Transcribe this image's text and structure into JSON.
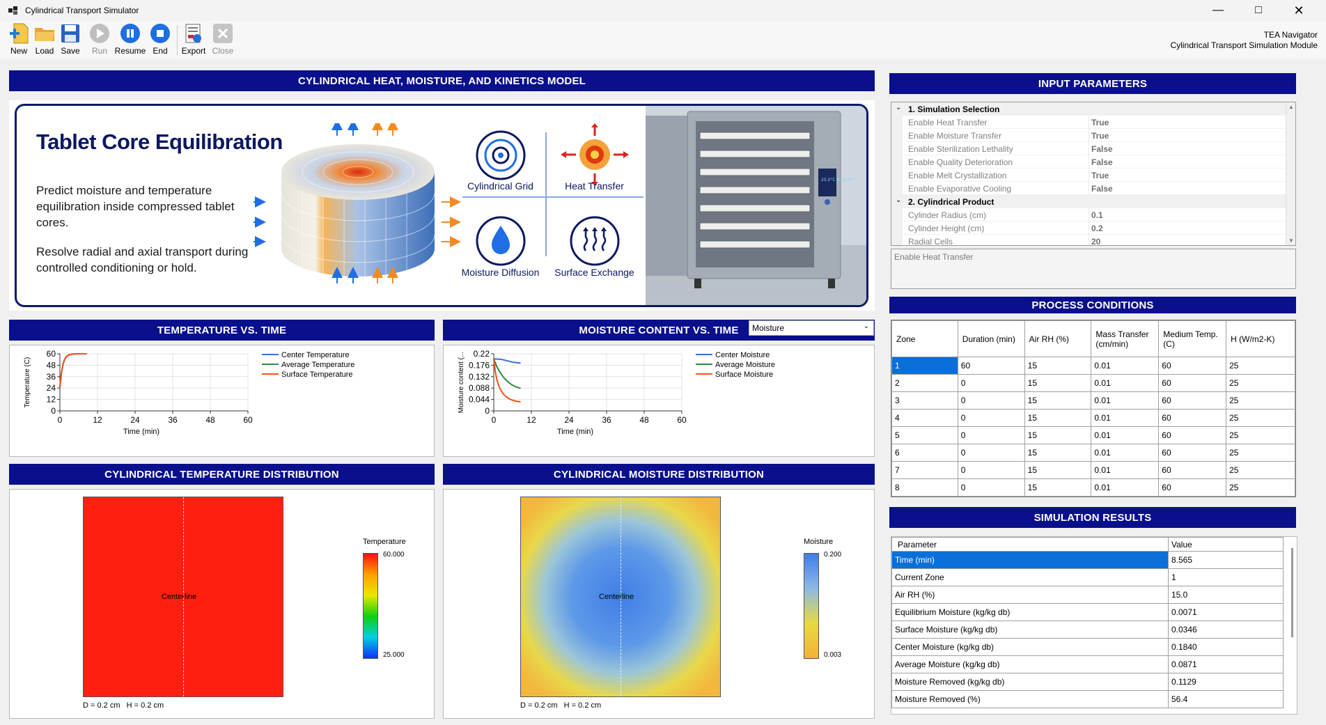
{
  "window": {
    "title": "Cylindrical Transport Simulator"
  },
  "toolbar": {
    "new": "New",
    "load": "Load",
    "save": "Save",
    "run": "Run",
    "resume": "Resume",
    "end": "End",
    "export": "Export",
    "close": "Close"
  },
  "app_info": {
    "line1": "TEA Navigator",
    "line2": "Cylindrical Transport Simulation Module"
  },
  "headers": {
    "model": "CYLINDRICAL HEAT, MOISTURE, AND KINETICS MODEL",
    "temp_time": "TEMPERATURE VS. TIME",
    "moist_time": "MOISTURE CONTENT VS. TIME",
    "temp_dist": "CYLINDRICAL TEMPERATURE DISTRIBUTION",
    "moist_dist": "CYLINDRICAL MOISTURE DISTRIBUTION",
    "inputs": "INPUT PARAMETERS",
    "process": "PROCESS CONDITIONS",
    "results": "SIMULATION RESULTS"
  },
  "banner": {
    "title": "Tablet Core Equilibration",
    "para1": "Predict moisture and temperature equilibration inside compressed tablet cores.",
    "para2": "Resolve radial and axial transport during controlled conditioning or hold.",
    "features": [
      "Cylindrical Grid",
      "Heat Transfer",
      "Moisture Diffusion",
      "Surface Exchange"
    ],
    "oven_display": "25.0°C 60% RH"
  },
  "moisture_select": "Moisture",
  "chart_data": [
    {
      "type": "line",
      "name": "temperature",
      "ylabel": "Temperature (C)",
      "xlabel": "Time (min)",
      "xticks": [
        0,
        12,
        24,
        36,
        48,
        60
      ],
      "yticks": [
        0,
        12,
        24,
        36,
        48,
        60
      ],
      "xlim": [
        0,
        60
      ],
      "ylim": [
        0,
        60
      ],
      "series": [
        {
          "name": "Center Temperature",
          "color": "#3a6fd8",
          "x": [
            0,
            0.5,
            1,
            1.5,
            2,
            3,
            4,
            5,
            6,
            7,
            8.565
          ],
          "y": [
            25,
            40,
            49,
            54,
            57,
            59,
            59.6,
            59.9,
            60,
            60,
            60
          ]
        },
        {
          "name": "Average Temperature",
          "color": "#2e8b3e",
          "x": [
            0,
            0.5,
            1,
            1.5,
            2,
            3,
            4,
            5,
            6,
            7,
            8.565
          ],
          "y": [
            25,
            40,
            49,
            54,
            57,
            59,
            59.6,
            59.9,
            60,
            60,
            60
          ]
        },
        {
          "name": "Surface Temperature",
          "color": "#f0521e",
          "x": [
            0,
            0.5,
            1,
            1.5,
            2,
            3,
            4,
            5,
            6,
            7,
            8.565
          ],
          "y": [
            25,
            40,
            49,
            54,
            57,
            59,
            59.6,
            59.9,
            60,
            60,
            60
          ]
        }
      ]
    },
    {
      "type": "line",
      "name": "moisture",
      "ylabel": "Moisture content (...",
      "xlabel": "Time (min)",
      "xticks": [
        0,
        12,
        24,
        36,
        48,
        60
      ],
      "yticks": [
        0,
        0.044,
        0.088,
        0.132,
        0.176,
        0.22
      ],
      "xlim": [
        0,
        60
      ],
      "ylim": [
        0,
        0.22
      ],
      "series": [
        {
          "name": "Center Moisture",
          "color": "#3a6fd8",
          "x": [
            0,
            1,
            2,
            3,
            4,
            5,
            6,
            7,
            8.565
          ],
          "y": [
            0.2,
            0.2,
            0.199,
            0.197,
            0.194,
            0.191,
            0.188,
            0.186,
            0.184
          ]
        },
        {
          "name": "Average Moisture",
          "color": "#2e8b3e",
          "x": [
            0,
            1,
            2,
            3,
            4,
            5,
            6,
            7,
            8.565
          ],
          "y": [
            0.2,
            0.17,
            0.148,
            0.131,
            0.118,
            0.107,
            0.099,
            0.093,
            0.0871
          ]
        },
        {
          "name": "Surface Moisture",
          "color": "#f0521e",
          "x": [
            0,
            0.5,
            1,
            1.5,
            2,
            3,
            4,
            5,
            6,
            7,
            8.565
          ],
          "y": [
            0.2,
            0.15,
            0.12,
            0.1,
            0.085,
            0.066,
            0.054,
            0.046,
            0.041,
            0.038,
            0.0346
          ]
        }
      ]
    }
  ],
  "temp_dist": {
    "centerline": "Centerline",
    "dims": "D = 0.2 cm   H = 0.2 cm",
    "legend_title": "Temperature",
    "max": "60.000",
    "min": "25.000"
  },
  "moist_dist": {
    "centerline": "Centerline",
    "dims": "D = 0.2 cm   H = 0.2 cm",
    "legend_title": "Moisture",
    "max": "0.200",
    "min": "0.003"
  },
  "property_grid": {
    "rows": [
      {
        "type": "cat",
        "label": "1. Simulation Selection"
      },
      {
        "type": "prop",
        "label": "Enable Heat Transfer",
        "value": "True"
      },
      {
        "type": "prop",
        "label": "Enable Moisture Transfer",
        "value": "True"
      },
      {
        "type": "prop",
        "label": "Enable Sterilization Lethality",
        "value": "False"
      },
      {
        "type": "prop",
        "label": "Enable Quality Deterioration",
        "value": "False"
      },
      {
        "type": "prop",
        "label": "Enable Melt Crystallization",
        "value": "True"
      },
      {
        "type": "prop",
        "label": "Enable Evaporative Cooling",
        "value": "False"
      },
      {
        "type": "cat",
        "label": "2. Cylindrical Product"
      },
      {
        "type": "prop",
        "label": "Cylinder Radius (cm)",
        "value": "0.1"
      },
      {
        "type": "prop",
        "label": "Cylinder Height (cm)",
        "value": "0.2"
      },
      {
        "type": "prop",
        "label": "Radial Cells",
        "value": "20"
      }
    ],
    "description": "Enable Heat Transfer"
  },
  "process": {
    "columns": [
      "Zone",
      "Duration (min)",
      "Air RH (%)",
      "Mass Transfer (cm/min)",
      "Medium Temp. (C)",
      "H (W/m2-K)"
    ],
    "rows": [
      [
        "1",
        "60",
        "15",
        "0.01",
        "60",
        "25"
      ],
      [
        "2",
        "0",
        "15",
        "0.01",
        "60",
        "25"
      ],
      [
        "3",
        "0",
        "15",
        "0.01",
        "60",
        "25"
      ],
      [
        "4",
        "0",
        "15",
        "0.01",
        "60",
        "25"
      ],
      [
        "5",
        "0",
        "15",
        "0.01",
        "60",
        "25"
      ],
      [
        "6",
        "0",
        "15",
        "0.01",
        "60",
        "25"
      ],
      [
        "7",
        "0",
        "15",
        "0.01",
        "60",
        "25"
      ],
      [
        "8",
        "0",
        "15",
        "0.01",
        "60",
        "25"
      ]
    ]
  },
  "results": {
    "columns": [
      "Parameter",
      "Value"
    ],
    "rows": [
      [
        "Time (min)",
        "8.565"
      ],
      [
        "Current Zone",
        "1"
      ],
      [
        "Air RH (%)",
        "15.0"
      ],
      [
        "Equilibrium Moisture (kg/kg db)",
        "0.0071"
      ],
      [
        "Surface Moisture (kg/kg db)",
        "0.0346"
      ],
      [
        "Center Moisture (kg/kg db)",
        "0.1840"
      ],
      [
        "Average Moisture (kg/kg db)",
        "0.0871"
      ],
      [
        "Moisture Removed (kg/kg db)",
        "0.1129"
      ],
      [
        "Moisture Removed (%)",
        "56.4"
      ]
    ]
  }
}
